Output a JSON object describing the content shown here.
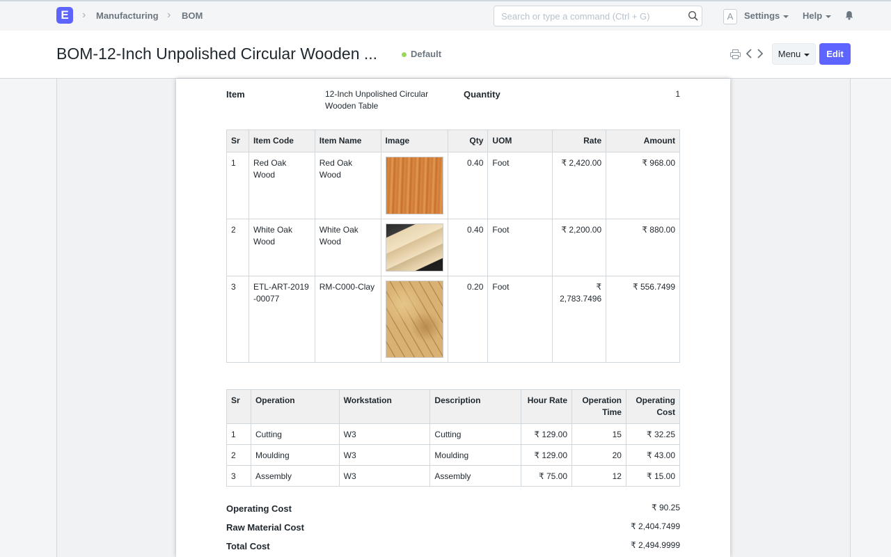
{
  "nav": {
    "logo": "E",
    "breadcrumbs": [
      "Manufacturing",
      "BOM"
    ],
    "search_placeholder": "Search or type a command (Ctrl + G)",
    "avatar": "A",
    "settings": "Settings",
    "help": "Help"
  },
  "header": {
    "title": "BOM-12-Inch Unpolished Circular Wooden ...",
    "status": "Default",
    "status_color": "#98d85b",
    "menu_label": "Menu",
    "edit_label": "Edit"
  },
  "doc": {
    "item_label": "Item",
    "item_value_line1": "12-Inch Unpolished Circular",
    "item_value_line2": "Wooden Table",
    "quantity_label": "Quantity",
    "quantity_value": "1",
    "items_headers": [
      "Sr",
      "Item Code",
      "Item Name",
      "Image",
      "Qty",
      "UOM",
      "Rate",
      "Amount"
    ],
    "items": [
      {
        "sr": "1",
        "item_code": "Red Oak Wood",
        "item_name": "Red Oak Wood",
        "image": "red-oak-wood-image",
        "qty": "0.40",
        "uom": "Foot",
        "rate": "₹ 2,420.00",
        "amount": "₹ 968.00"
      },
      {
        "sr": "2",
        "item_code": "White Oak Wood",
        "item_name": "White Oak Wood",
        "image": "white-oak-wood-image",
        "qty": "0.40",
        "uom": "Foot",
        "rate": "₹ 2,200.00",
        "amount": "₹ 880.00"
      },
      {
        "sr": "3",
        "item_code": "ETL-ART-2019-00077",
        "item_name": "RM-C000-Clay",
        "image": "clay-image",
        "qty": "0.20",
        "uom": "Foot",
        "rate": "₹ 2,783.7496",
        "amount": "₹ 556.7499"
      }
    ],
    "ops_headers": [
      "Sr",
      "Operation",
      "Workstation",
      "Description",
      "Hour Rate",
      "Operation Time",
      "Operating Cost"
    ],
    "operations": [
      {
        "sr": "1",
        "operation": "Cutting",
        "workstation": "W3",
        "description": "Cutting",
        "hour_rate": "₹ 129.00",
        "time": "15",
        "cost": "₹ 32.25"
      },
      {
        "sr": "2",
        "operation": "Moulding",
        "workstation": "W3",
        "description": "Moulding",
        "hour_rate": "₹ 129.00",
        "time": "20",
        "cost": "₹ 43.00"
      },
      {
        "sr": "3",
        "operation": "Assembly",
        "workstation": "W3",
        "description": "Assembly",
        "hour_rate": "₹ 75.00",
        "time": "12",
        "cost": "₹ 15.00"
      }
    ],
    "totals": [
      {
        "label": "Operating Cost",
        "value": "₹ 90.25"
      },
      {
        "label": "Raw Material Cost",
        "value": "₹ 2,404.7499"
      },
      {
        "label": "Total Cost",
        "value": "₹ 2,494.9999"
      }
    ]
  }
}
